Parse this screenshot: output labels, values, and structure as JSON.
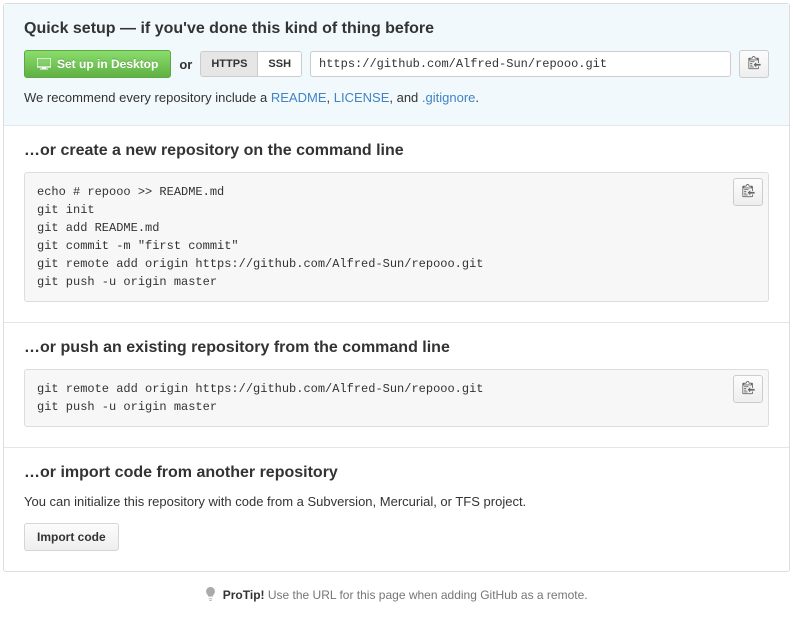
{
  "quick_setup": {
    "title": "Quick setup — if you've done this kind of thing before",
    "desktop_btn": "Set up in Desktop",
    "or": "or",
    "https_label": "HTTPS",
    "ssh_label": "SSH",
    "url": "https://github.com/Alfred-Sun/repooo.git",
    "recommend_prefix": "We recommend every repository include a ",
    "readme": "README",
    "comma1": ", ",
    "license": "LICENSE",
    "comma2": ", and ",
    "gitignore": ".gitignore",
    "period": "."
  },
  "create_repo": {
    "title": "…or create a new repository on the command line",
    "code": "echo # repooo >> README.md\ngit init\ngit add README.md\ngit commit -m \"first commit\"\ngit remote add origin https://github.com/Alfred-Sun/repooo.git\ngit push -u origin master"
  },
  "push_repo": {
    "title": "…or push an existing repository from the command line",
    "code": "git remote add origin https://github.com/Alfred-Sun/repooo.git\ngit push -u origin master"
  },
  "import_repo": {
    "title": "…or import code from another repository",
    "text": "You can initialize this repository with code from a Subversion, Mercurial, or TFS project.",
    "button": "Import code"
  },
  "protip": {
    "label": "ProTip!",
    "text": " Use the URL for this page when adding GitHub as a remote."
  }
}
